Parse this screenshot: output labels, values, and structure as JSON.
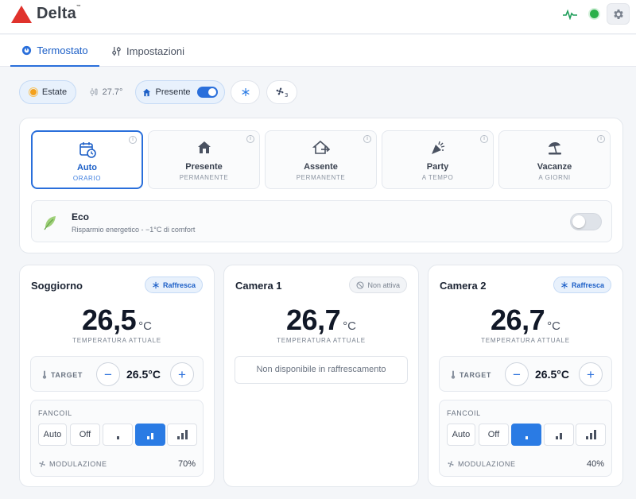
{
  "app": {
    "brand": "Delta",
    "tm": "™",
    "accent": "#2a6fdb",
    "brand_red": "#e0322c"
  },
  "tabs": [
    {
      "label": "Termostato",
      "icon": "thermostat-icon",
      "active": true
    },
    {
      "label": "Impostazioni",
      "icon": "sliders-icon",
      "active": false
    }
  ],
  "chips": {
    "season": "Estate",
    "outdoor_temp": "27.7°",
    "presence": "Presente",
    "presence_on": true
  },
  "modes": [
    {
      "label": "Auto",
      "sub": "ORARIO",
      "icon": "calendar-clock-icon",
      "active": true
    },
    {
      "label": "Presente",
      "sub": "PERMANENTE",
      "icon": "home-icon",
      "active": false
    },
    {
      "label": "Assente",
      "sub": "PERMANENTE",
      "icon": "home-out-icon",
      "active": false
    },
    {
      "label": "Party",
      "sub": "A TEMPO",
      "icon": "party-popper-icon",
      "active": false
    },
    {
      "label": "Vacanze",
      "sub": "A GIORNI",
      "icon": "beach-umbrella-icon",
      "active": false
    }
  ],
  "eco": {
    "title": "Eco",
    "subtitle": "Risparmio energetico - −1°C di comfort",
    "enabled": false
  },
  "zones": [
    {
      "name": "Soggiorno",
      "badge": "Raffresca",
      "temp": "26,5",
      "unit": "°C",
      "temp_label": "TEMPERATURA ATTUALE",
      "target_label": "TARGET",
      "target": "26.5°C",
      "fancoil_label": "FANCOIL",
      "fan_auto": "Auto",
      "fan_off": "Off",
      "fan_speed_active": 2,
      "mod_label": "MODULAZIONE",
      "mod_value": "70%"
    },
    {
      "name": "Camera 1",
      "badge": "Non attiva",
      "temp": "26,7",
      "unit": "°C",
      "temp_label": "TEMPERATURA ATTUALE",
      "message": "Non disponibile in raffrescamento"
    },
    {
      "name": "Camera 2",
      "badge": "Raffresca",
      "temp": "26,7",
      "unit": "°C",
      "temp_label": "TEMPERATURA ATTUALE",
      "target_label": "TARGET",
      "target": "26.5°C",
      "fancoil_label": "FANCOIL",
      "fan_auto": "Auto",
      "fan_off": "Off",
      "fan_speed_active": 1,
      "mod_label": "MODULAZIONE",
      "mod_value": "40%"
    }
  ]
}
